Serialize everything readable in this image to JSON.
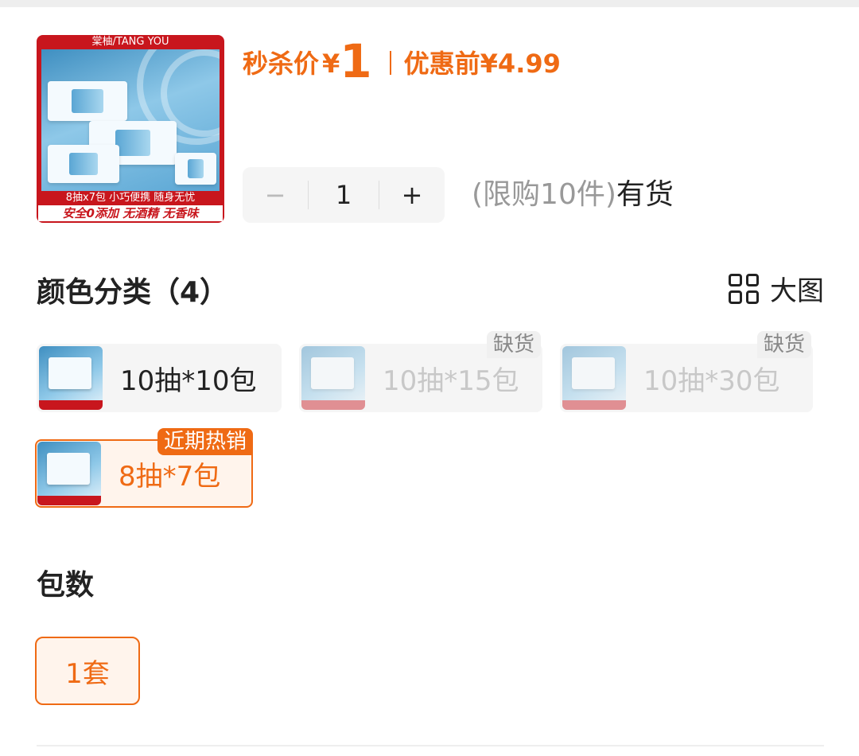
{
  "product_image": {
    "brand": "棠柚/TANG YOU",
    "caption_1": "8抽x7包 小巧便携 随身无忧",
    "caption_2": "安全0添加 无酒精 无香味"
  },
  "price": {
    "flash_label": "秒杀价",
    "currency": "¥",
    "flash_price": "1",
    "before_label": "优惠前",
    "original_price": "¥4.99"
  },
  "quantity": {
    "minus": "−",
    "value": "1",
    "plus": "+",
    "limit_text": "(限购10件)",
    "stock_text": "有货"
  },
  "color_section": {
    "title": "颜色分类（4）",
    "big_view_label": "大图",
    "options": [
      {
        "label": "10抽*10包",
        "available": true,
        "selected": false,
        "tag": ""
      },
      {
        "label": "10抽*15包",
        "available": false,
        "selected": false,
        "tag": "缺货"
      },
      {
        "label": "10抽*30包",
        "available": false,
        "selected": false,
        "tag": "缺货"
      },
      {
        "label": "8抽*7包",
        "available": true,
        "selected": true,
        "tag": "近期热销"
      }
    ]
  },
  "pack_section": {
    "title": "包数",
    "options": [
      {
        "label": "1套",
        "selected": true
      }
    ]
  },
  "colors": {
    "accent": "#ef6a14",
    "brand_red": "#c8161d"
  }
}
